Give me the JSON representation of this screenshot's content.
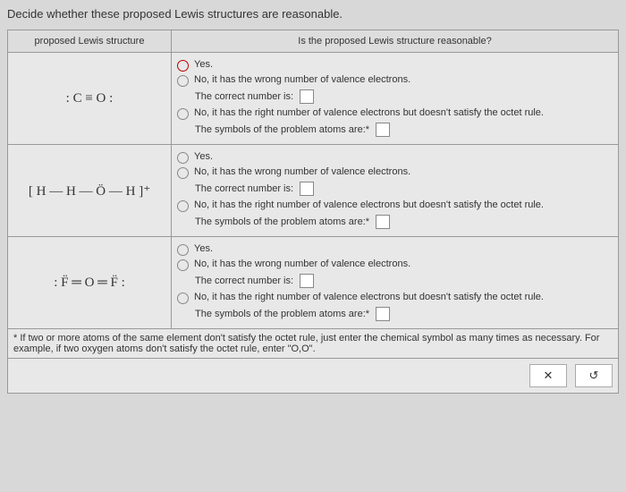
{
  "instruction": "Decide whether these proposed Lewis structures are reasonable.",
  "header": {
    "left": "proposed Lewis structure",
    "right": "Is the proposed Lewis structure reasonable?"
  },
  "opts": {
    "yes": "Yes.",
    "nov": "No, it has the wrong number of valence electrons.",
    "nov_sub": "The correct number is:",
    "noo": "No, it has the right number of valence electrons but doesn't satisfy the octet rule.",
    "noo_sub": "The symbols of the problem atoms are:*"
  },
  "structs": {
    "s1": ": C ≡ O :",
    "s2": "[ H — H — Ö — H ]⁺",
    "s3": ": F̈ ═ O ═ F̈ :"
  },
  "footnote": "* If two or more atoms of the same element don't satisfy the octet rule, just enter the chemical symbol as many times as necessary. For example, if two oxygen atoms don't satisfy the octet rule, enter \"O,O\".",
  "btn": {
    "x": "✕",
    "r": "↺"
  }
}
